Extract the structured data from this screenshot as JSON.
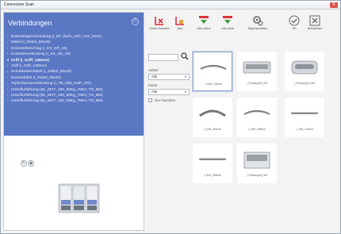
{
  "window": {
    "title": "Connection Scan",
    "close_glyph": "✕"
  },
  "tree": {
    "header": "Verbindungen",
    "header_icon": "ⓘ",
    "items": [
      {
        "label": "Bodenträgerverbindung (I_BT_flach_LRS_A32_5mm)",
        "selected": false
      },
      {
        "label": "Dübel (I_Dübel_08x40)",
        "selected": false
      },
      {
        "label": "Exzenterbeschlag (I_EX_SR_19)",
        "selected": false
      },
      {
        "label": "Exzenterverbindung (I_EX_SE_19)",
        "selected": false
      },
      {
        "label": "Griff (I_Griff_128mm)",
        "selected": true
      },
      {
        "label": "Griff (I_Griff_128mm)",
        "selected": false
      },
      {
        "label": "Schubkastendübel (I_Dübel_08x40)",
        "selected": false
      },
      {
        "label": "Sockeldübel (I_Dübel_08x40)",
        "selected": false
      },
      {
        "label": "Topfscharnierverbindung (I_TB_095_KMP_DO)",
        "selected": false
      },
      {
        "label": "Unterflurführung (BL_MVT_450_60Kg_766H_TO_BM)",
        "selected": false
      },
      {
        "label": "Unterflurführung (BL_MVT_450_60Kg_766H_TO_BM)",
        "selected": false
      },
      {
        "label": "Unterflurführung (BL_MVT_450_60Kg_766H_TO_BM)",
        "selected": false
      }
    ]
  },
  "toolbar": {
    "buttons": [
      {
        "name": "auswahl-loeschen",
        "label": "Keine Auswahl"
      },
      {
        "name": "neu",
        "label": "Neu"
      },
      {
        "name": "alle-online",
        "label": "Alle online"
      },
      {
        "name": "alle-lokal",
        "label": "Alle lokal"
      },
      {
        "name": "eigenschaften",
        "label": "Eigenschaften"
      },
      {
        "name": "ok",
        "label": "OK"
      },
      {
        "name": "abbrechen",
        "label": "Abbrechen"
      }
    ]
  },
  "filters": {
    "search_value": "",
    "label_1": "Artikel",
    "select_1": "Alle",
    "label_2": "Farbe",
    "select_2": "Alle",
    "checkbox_label": "Nur Favoriten"
  },
  "grid": {
    "tiles": [
      {
        "caption": "I_Griff_128mm",
        "kind": "bow",
        "selected": true
      },
      {
        "caption": "I_Einbaugriff_004",
        "kind": "recess",
        "selected": false
      },
      {
        "caption": "I_Einbaugriff_005",
        "kind": "recess2",
        "selected": false
      },
      {
        "caption": "I_Griff_064mm",
        "kind": "arc",
        "selected": false
      },
      {
        "caption": "I_Griff_096mm",
        "kind": "bow",
        "selected": false
      },
      {
        "caption": "I_Griff_224mm",
        "kind": "bar",
        "selected": false
      },
      {
        "caption": "I_Griff_288mm",
        "kind": "bar",
        "selected": false
      },
      {
        "caption": "I_Einbaugriff_003",
        "kind": "recess3",
        "selected": false
      }
    ]
  },
  "colors": {
    "tree_bg": "#5a77c4",
    "accent_red": "#d9333a",
    "accent_green": "#3c9b3f"
  }
}
